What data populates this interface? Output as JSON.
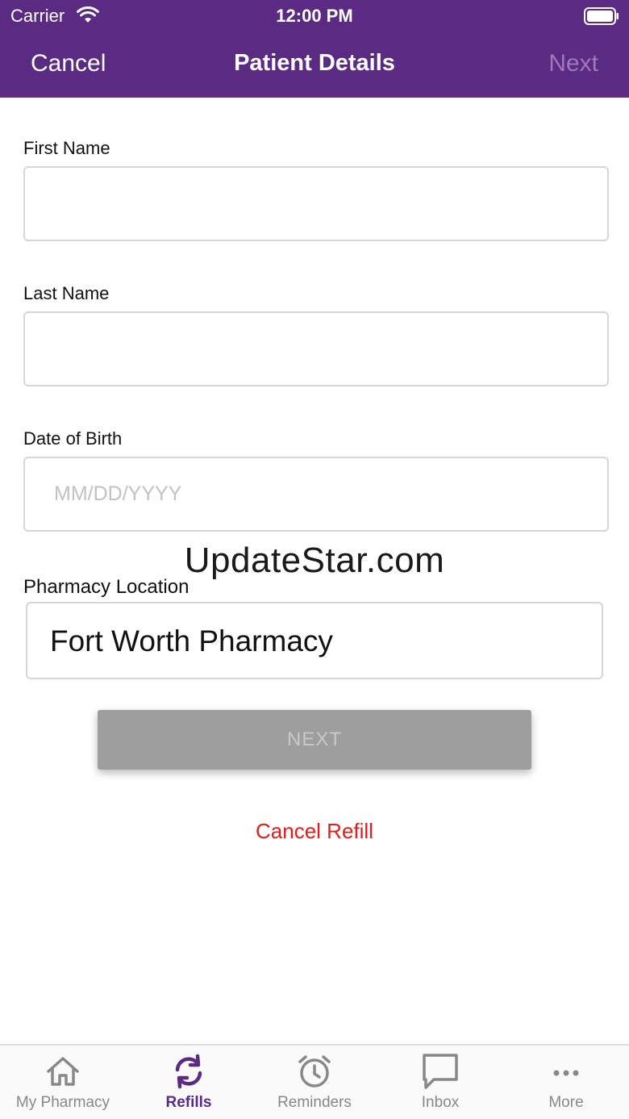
{
  "status_bar": {
    "carrier": "Carrier",
    "time": "12:00 PM",
    "wifi_icon": "wifi-icon",
    "battery_icon": "battery-icon"
  },
  "nav": {
    "cancel_label": "Cancel",
    "title": "Patient Details",
    "next_label": "Next"
  },
  "form": {
    "first_name": {
      "label": "First Name",
      "value": "",
      "placeholder": ""
    },
    "last_name": {
      "label": "Last Name",
      "value": "",
      "placeholder": ""
    },
    "dob": {
      "label": "Date of Birth",
      "value": "",
      "placeholder": "MM/DD/YYYY"
    },
    "pharmacy": {
      "label": "Pharmacy Location",
      "value": "Fort Worth Pharmacy"
    }
  },
  "watermark": "UpdateStar.com",
  "actions": {
    "next_button": "NEXT",
    "cancel_refill": "Cancel Refill"
  },
  "tabs": [
    {
      "label": "My Pharmacy",
      "icon": "home-icon",
      "active": false
    },
    {
      "label": "Refills",
      "icon": "refresh-icon",
      "active": true
    },
    {
      "label": "Reminders",
      "icon": "alarm-clock-icon",
      "active": false
    },
    {
      "label": "Inbox",
      "icon": "chat-bubble-icon",
      "active": false
    },
    {
      "label": "More",
      "icon": "more-dots-icon",
      "active": false
    }
  ],
  "colors": {
    "brand": "#5b2a82",
    "disabled_button": "#9e9e9e",
    "danger": "#e41b1b",
    "inactive_tab": "#888888"
  }
}
